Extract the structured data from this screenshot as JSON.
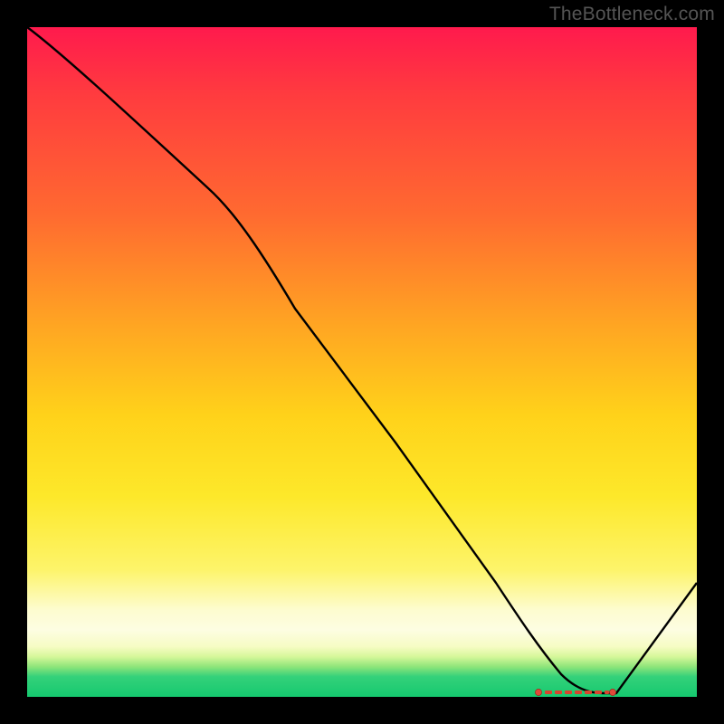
{
  "watermark": "TheBottleneck.com",
  "chart_data": {
    "type": "line",
    "title": "",
    "xlabel": "",
    "ylabel": "",
    "xlim": [
      0,
      100
    ],
    "ylim": [
      0,
      100
    ],
    "grid": false,
    "legend": false,
    "series": [
      {
        "name": "curve",
        "x": [
          0,
          10,
          20,
          27,
          40,
          55,
          70,
          77,
          82,
          86,
          88,
          100
        ],
        "y": [
          100,
          92,
          83,
          76,
          58,
          38,
          17,
          7,
          2,
          0.5,
          0.5,
          17
        ]
      }
    ],
    "annotations": {
      "baseline_marker": {
        "x_start": 77,
        "x_end": 87,
        "y": 0.6,
        "dot_left_x": 76.3,
        "dot_right_x": 87.4
      }
    },
    "colors": {
      "gradient_top": "#ff1a4d",
      "gradient_mid": "#ffd21a",
      "gradient_band": "#fdfde2",
      "gradient_bottom": "#15c96f",
      "curve": "#000000",
      "marker": "#e04a3a"
    }
  }
}
